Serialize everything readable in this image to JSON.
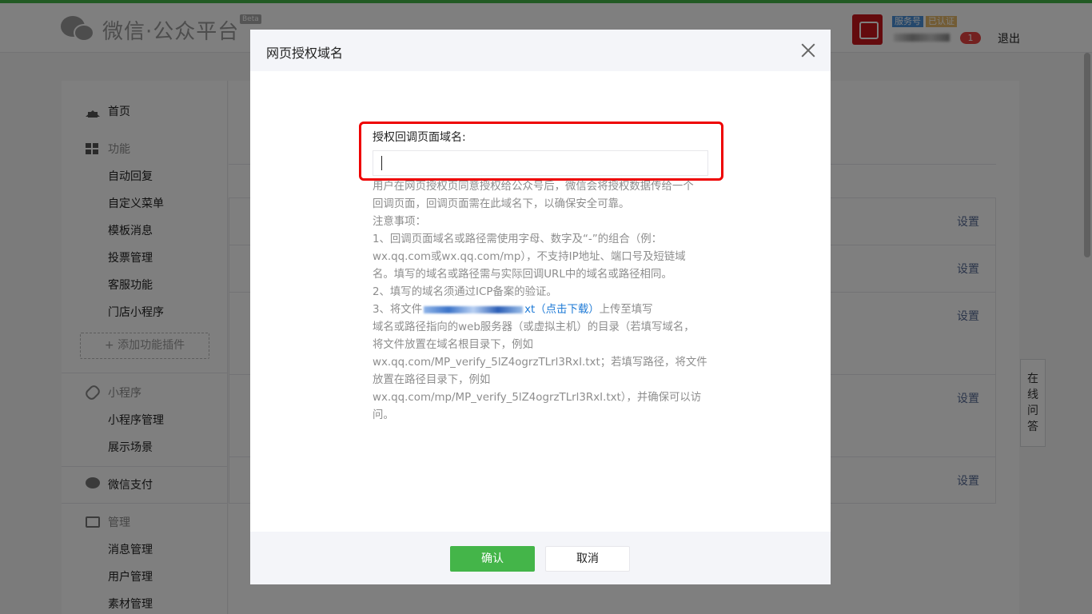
{
  "header": {
    "brand": "微信·公众平台",
    "beta": "Beta",
    "account_type": "服务号",
    "verified": "已认证",
    "message_count": "1",
    "logout": "退出"
  },
  "sidebar": {
    "home": "首页",
    "features_cat": "功能",
    "features": [
      "自动回复",
      "自定义菜单",
      "模板消息",
      "投票管理",
      "客服功能",
      "门店小程序"
    ],
    "add_plugin": "+ 添加功能插件",
    "miniapp_cat": "小程序",
    "miniapp": [
      "小程序管理",
      "展示场景"
    ],
    "pay": "微信支付",
    "manage_cat": "管理",
    "manage": [
      "消息管理",
      "用户管理",
      "素材管理"
    ]
  },
  "main": {
    "settings": [
      "设置",
      "设置",
      "设置",
      "设置",
      "设置"
    ]
  },
  "online_help": "在\n线\n问\n答",
  "dialog": {
    "title": "网页授权域名",
    "field_label": "授权回调页面域名:",
    "field_value": "",
    "desc": {
      "l1": "用户在网页授权页同意授权给公众号后，微信会将授权数据传给一个",
      "l2": "回调页面，回调页面需在此域名下，以确保安全可靠。",
      "l3": "注意事项：",
      "l4": "1、回调页面域名或路径需使用字母、数字及“-”的组合（例：",
      "l5": "wx.qq.com或wx.qq.com/mp），不支持IP地址、端口号及短链域",
      "l6": "名。填写的域名或路径需与实际回调URL中的域名或路径相同。",
      "l7": "2、填写的域名须通过ICP备案的验证。",
      "l8_prefix": "3、将文件",
      "l8_link": "xt（点击下载）",
      "l8_suffix": "上传至填写",
      "l9": "域名或路径指向的web服务器（或虚拟主机）的目录（若填写域名，",
      "l10": "将文件放置在域名根目录下，例如",
      "l11": "wx.qq.com/MP_verify_5lZ4ogrzTLrl3RxI.txt；若填写路径，将文件",
      "l12": "放置在路径目录下，例如",
      "l13": "wx.qq.com/mp/MP_verify_5lZ4ogrzTLrl3RxI.txt），并确保可以访",
      "l14": "问。"
    },
    "ok": "确认",
    "cancel": "取消"
  },
  "colors": {
    "brand_green": "#44b549",
    "link_blue": "#1e7ad6",
    "highlight_red": "#e00000",
    "badge_red": "#e64340"
  }
}
